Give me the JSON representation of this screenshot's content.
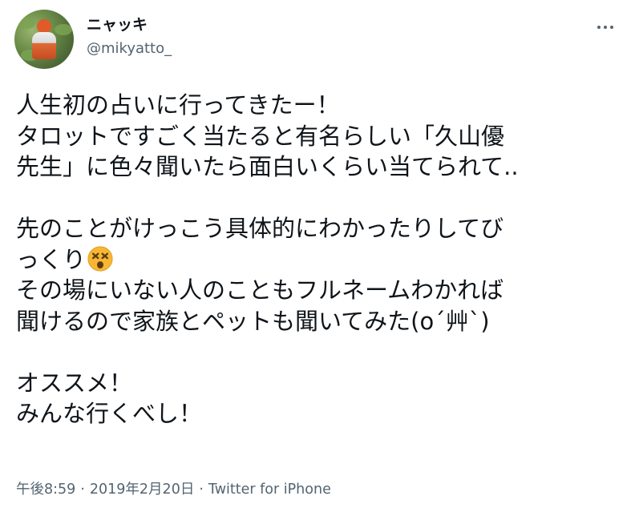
{
  "user": {
    "display_name": "ニャッキ",
    "handle": "@mikyatto_",
    "avatar_icon": "avatar-photo"
  },
  "more_button": {
    "icon": "more-horizontal-icon"
  },
  "tweet": {
    "lines": [
      "人生初の占いに行ってきたー！",
      "タロットですごく当たると有名らしい「久山優",
      "先生」に色々聞いたら面白いくらい当てられて..",
      "",
      "先のことがけっこう具体的にわかったりしてび",
      "っくり",
      "その場にいない人のこともフルネームわかれば",
      "聞けるので家族とペットも聞いてみた(o´艸`)",
      "",
      "オススメ！",
      "みんな行くべし！"
    ],
    "emoji_after_line_6": "dizzy-face-emoji"
  },
  "meta": {
    "time": "午後8:59",
    "separator": "·",
    "date": "2019年2月20日",
    "source": "Twitter for iPhone"
  },
  "colors": {
    "text_primary": "#0f1419",
    "text_secondary": "#536471",
    "background": "#ffffff",
    "emoji_face": "#f7b733"
  }
}
